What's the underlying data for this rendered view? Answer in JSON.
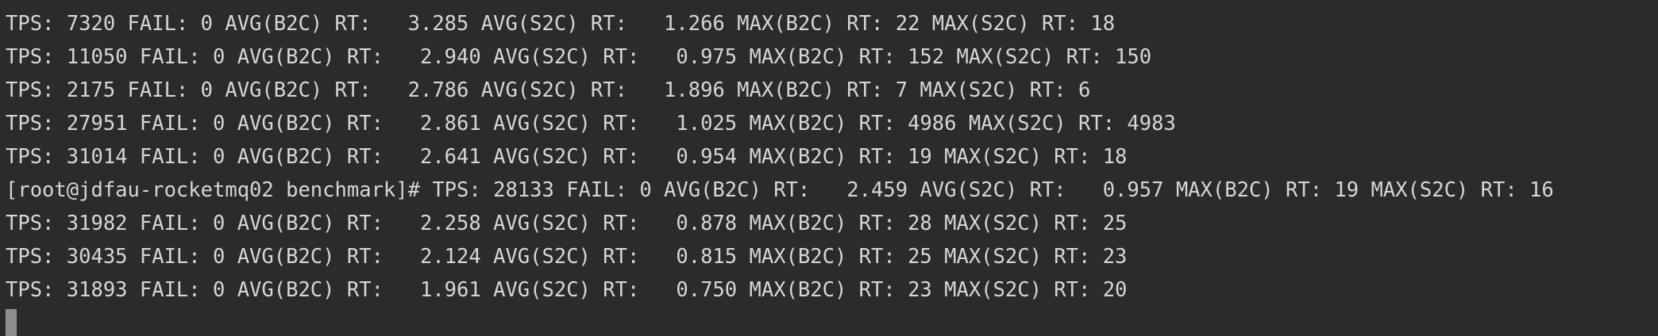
{
  "terminal": {
    "lines": [
      "TPS: 7320 FAIL: 0 AVG(B2C) RT:   3.285 AVG(S2C) RT:   1.266 MAX(B2C) RT: 22 MAX(S2C) RT: 18",
      "TPS: 11050 FAIL: 0 AVG(B2C) RT:   2.940 AVG(S2C) RT:   0.975 MAX(B2C) RT: 152 MAX(S2C) RT: 150",
      "TPS: 2175 FAIL: 0 AVG(B2C) RT:   2.786 AVG(S2C) RT:   1.896 MAX(B2C) RT: 7 MAX(S2C) RT: 6",
      "TPS: 27951 FAIL: 0 AVG(B2C) RT:   2.861 AVG(S2C) RT:   1.025 MAX(B2C) RT: 4986 MAX(S2C) RT: 4983",
      "TPS: 31014 FAIL: 0 AVG(B2C) RT:   2.641 AVG(S2C) RT:   0.954 MAX(B2C) RT: 19 MAX(S2C) RT: 18",
      "[root@jdfau-rocketmq02 benchmark]# TPS: 28133 FAIL: 0 AVG(B2C) RT:   2.459 AVG(S2C) RT:   0.957 MAX(B2C) RT: 19 MAX(S2C) RT: 16",
      "TPS: 31982 FAIL: 0 AVG(B2C) RT:   2.258 AVG(S2C) RT:   0.878 MAX(B2C) RT: 28 MAX(S2C) RT: 25",
      "TPS: 30435 FAIL: 0 AVG(B2C) RT:   2.124 AVG(S2C) RT:   0.815 MAX(B2C) RT: 25 MAX(S2C) RT: 23",
      "TPS: 31893 FAIL: 0 AVG(B2C) RT:   1.961 AVG(S2C) RT:   0.750 MAX(B2C) RT: 23 MAX(S2C) RT: 20"
    ]
  },
  "colors": {
    "background": "#2b2b2b",
    "text": "#d6d6d6",
    "cursor": "#8f8f8f"
  }
}
